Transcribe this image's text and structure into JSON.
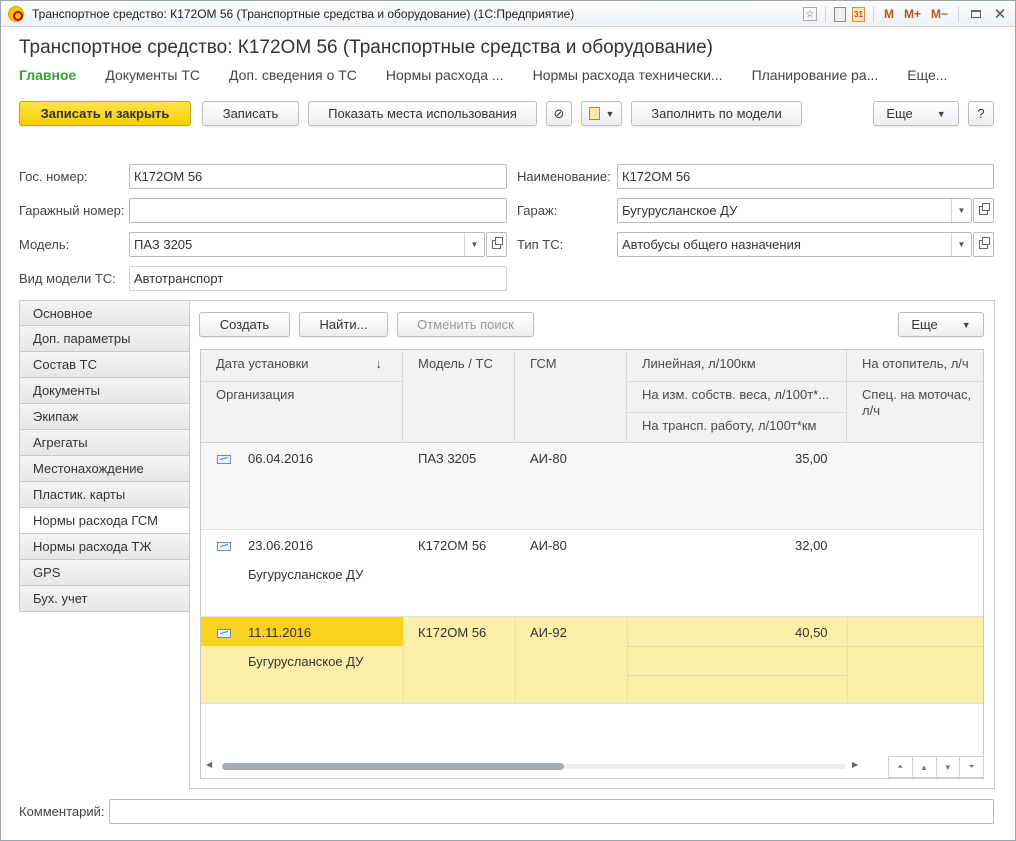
{
  "window": {
    "title": "Транспортное средство: К172ОМ 56 (Транспортные средства и оборудование)  (1С:Предприятие)",
    "title_icons": [
      "☆",
      "M",
      "M+",
      "M−"
    ]
  },
  "form": {
    "title": "Транспортное средство: К172ОМ 56 (Транспортные средства и оборудование)"
  },
  "nav": {
    "items": [
      {
        "label": "Главное"
      },
      {
        "label": "Документы ТС"
      },
      {
        "label": "Доп. сведения о ТС"
      },
      {
        "label": "Нормы расхода ..."
      },
      {
        "label": "Нормы расхода технически..."
      },
      {
        "label": "Планирование ра..."
      },
      {
        "label": "Еще..."
      }
    ]
  },
  "toolbar": {
    "save_close": "Записать и закрыть",
    "save": "Записать",
    "show_usage": "Показать места использования",
    "fill_by_model": "Заполнить по модели",
    "more": "Еще",
    "help": "?"
  },
  "fields": {
    "gos_nomer": {
      "label": "Гос. номер:",
      "value": "К172ОМ 56"
    },
    "naimenovanie": {
      "label": "Наименование:",
      "value": "К172ОМ 56"
    },
    "garazh_nomer": {
      "label": "Гаражный номер:",
      "value": ""
    },
    "garazh": {
      "label": "Гараж:",
      "value": "Бугурусланское ДУ"
    },
    "model": {
      "label": "Модель:",
      "value": "ПАЗ 3205"
    },
    "tip_ts": {
      "label": "Тип ТС:",
      "value": "Автобусы общего назначения"
    },
    "vid_modeli": {
      "label": "Вид модели ТС:",
      "value": "Автотранспорт"
    },
    "comment": {
      "label": "Комментарий:",
      "value": ""
    }
  },
  "side_tabs": [
    {
      "label": "Основное"
    },
    {
      "label": "Доп. параметры"
    },
    {
      "label": "Состав ТС"
    },
    {
      "label": "Документы"
    },
    {
      "label": "Экипаж"
    },
    {
      "label": "Агрегаты"
    },
    {
      "label": "Местонахождение"
    },
    {
      "label": "Пластик. карты"
    },
    {
      "label": "Нормы расхода ГСМ"
    },
    {
      "label": "Нормы расхода ТЖ"
    },
    {
      "label": "GPS"
    },
    {
      "label": "Бух. учет"
    }
  ],
  "grid_toolbar": {
    "create": "Создать",
    "find": "Найти...",
    "cancel_search": "Отменить поиск",
    "more": "Еще"
  },
  "grid": {
    "headers": {
      "date": "Дата установки",
      "sort_arrow": "↓",
      "org": "Организация",
      "model": "Модель / ТС",
      "gsm": "ГСМ",
      "linear": "Линейная, л/100км",
      "own_weight": "На изм. собств. веса, л/100т*...",
      "transport_work": "На трансп. работу, л/100т*км",
      "heater": "На отопитель, л/ч",
      "spec_1": "Спец. на моточас,",
      "spec_2": "л/ч"
    },
    "rows": [
      {
        "date": "06.04.2016",
        "org": "",
        "model": "ПАЗ 3205",
        "gsm": "АИ-80",
        "linear": "35,00"
      },
      {
        "date": "23.06.2016",
        "org": "Бугурусланское ДУ",
        "model": "К172ОМ 56",
        "gsm": "АИ-80",
        "linear": "32,00"
      },
      {
        "date": "11.11.2016",
        "org": "Бугурусланское ДУ",
        "model": "К172ОМ 56",
        "gsm": "АИ-92",
        "linear": "40,50"
      }
    ]
  },
  "colors": {
    "accent_green": "#3aa03a",
    "primary_yellow": "#f6ce00",
    "selected_row": "#fcefa9",
    "selected_cell": "#f8d21c"
  }
}
